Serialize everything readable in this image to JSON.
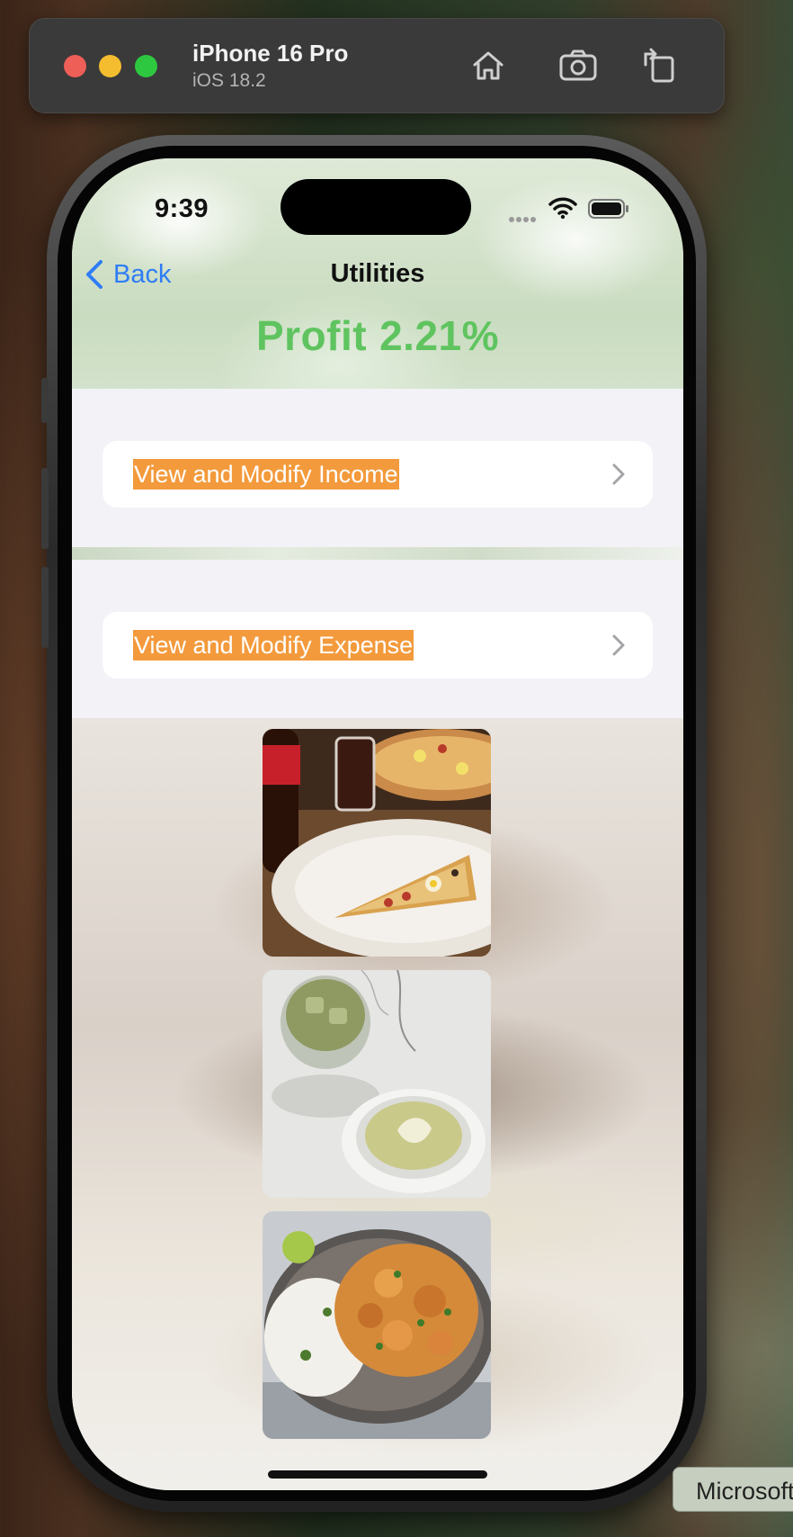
{
  "simulator": {
    "device_name": "iPhone 16 Pro",
    "os_version": "iOS 18.2"
  },
  "status_bar": {
    "time": "9:39"
  },
  "nav": {
    "back_label": "Back",
    "title": "Utilities"
  },
  "profit": {
    "label": "Profit",
    "value": "2.21%",
    "color": "#5fc45f"
  },
  "rows": [
    {
      "label": "View and Modify Income"
    },
    {
      "label": "View and Modify Expense"
    }
  ],
  "colors": {
    "accent_blue": "#2f7cf6",
    "highlight_orange": "#f39a3c",
    "list_background": "#f2f2f7"
  },
  "tooltip": {
    "text": "Microsoft"
  }
}
